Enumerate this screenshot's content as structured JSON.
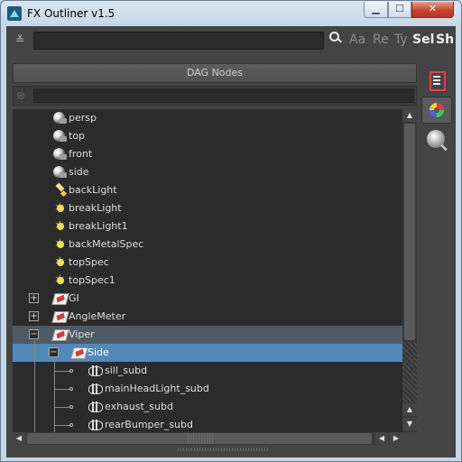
{
  "window": {
    "title": "FX Outliner v1.5"
  },
  "toolbar": {
    "search_value": "",
    "options": [
      {
        "label": "Aa",
        "active": false
      },
      {
        "label": "Re",
        "active": false
      },
      {
        "label": "Ty",
        "active": false
      },
      {
        "label": "Sel",
        "active": true
      },
      {
        "label": "Sh",
        "active": true
      }
    ]
  },
  "panel": {
    "header": "DAG Nodes",
    "filter_value": ""
  },
  "tree": {
    "rows": [
      {
        "label": "persp",
        "type": "camera"
      },
      {
        "label": "top",
        "type": "camera"
      },
      {
        "label": "front",
        "type": "camera"
      },
      {
        "label": "side",
        "type": "camera"
      },
      {
        "label": "backLight",
        "type": "spotlight"
      },
      {
        "label": "breakLight",
        "type": "light"
      },
      {
        "label": "breakLight1",
        "type": "light"
      },
      {
        "label": "backMetalSpec",
        "type": "light"
      },
      {
        "label": "topSpec",
        "type": "light"
      },
      {
        "label": "topSpec1",
        "type": "light"
      },
      {
        "label": "GI",
        "type": "transform",
        "expander": "+"
      },
      {
        "label": "AngleMeter",
        "type": "transform",
        "expander": "+"
      },
      {
        "label": "Viper",
        "type": "transform",
        "expander": "−"
      },
      {
        "label": "Side",
        "type": "transform",
        "expander": "−",
        "selected": true
      },
      {
        "label": "sill_subd",
        "type": "mesh"
      },
      {
        "label": "mainHeadLight_subd",
        "type": "mesh"
      },
      {
        "label": "exhaust_subd",
        "type": "mesh"
      },
      {
        "label": "rearBumper_subd",
        "type": "mesh"
      }
    ]
  },
  "icons": {
    "filter": "filter-icon",
    "search": "search-icon",
    "side_buttons": [
      "outliner-list-icon",
      "color-wheel-icon",
      "render-sphere-icon"
    ]
  },
  "colors": {
    "selection": "#5289b8",
    "parent_highlight": "#4e5a66",
    "close_button": "#c8442c"
  }
}
